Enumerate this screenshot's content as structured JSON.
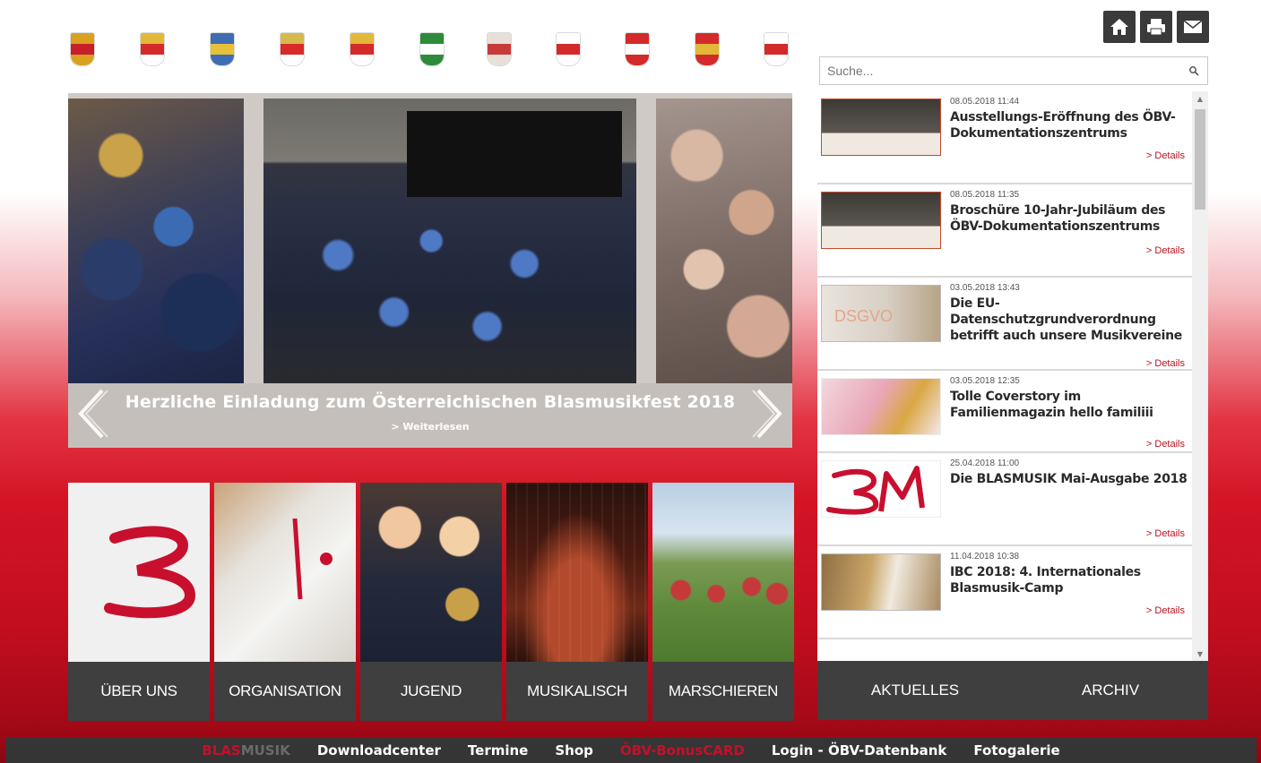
{
  "crests": [
    {
      "name": "crest-burgenland",
      "colors": [
        "#d9a11f",
        "#c8202b",
        "#d9a11f"
      ]
    },
    {
      "name": "crest-kaernten",
      "colors": [
        "#e2b838",
        "#d42a2a",
        "#ffffff"
      ]
    },
    {
      "name": "crest-niederoesterreich",
      "colors": [
        "#3f6db3",
        "#e8c13a",
        "#3f6db3"
      ]
    },
    {
      "name": "crest-oberoesterreich",
      "colors": [
        "#d6b94c",
        "#d82a2a",
        "#ffffff"
      ]
    },
    {
      "name": "crest-salzburg",
      "colors": [
        "#e2b838",
        "#d42a2a",
        "#ffffff"
      ]
    },
    {
      "name": "crest-steiermark",
      "colors": [
        "#2e8b3a",
        "#ffffff",
        "#2e8b3a"
      ]
    },
    {
      "name": "crest-suedtirol",
      "colors": [
        "#e8e0d8",
        "#c83a3a",
        "#e8e0d8"
      ]
    },
    {
      "name": "crest-tirol",
      "colors": [
        "#ffffff",
        "#d42a2a",
        "#ffffff"
      ]
    },
    {
      "name": "crest-vorarlberg",
      "colors": [
        "#d42a2a",
        "#ffffff",
        "#d42a2a"
      ]
    },
    {
      "name": "crest-wien",
      "colors": [
        "#d42a2a",
        "#e2b838",
        "#d42a2a"
      ]
    },
    {
      "name": "crest-liechtenstein",
      "colors": [
        "#ffffff",
        "#d42a2a",
        "#ffffff"
      ]
    }
  ],
  "top_icons": [
    {
      "name": "home-icon"
    },
    {
      "name": "printer-icon"
    },
    {
      "name": "mail-icon"
    }
  ],
  "search": {
    "placeholder": "Suche..."
  },
  "slider": {
    "title": "Herzliche Einladung zum Österreichischen Blasmusikfest 2018",
    "link": "> Weiterlesen"
  },
  "tiles": [
    {
      "name": "tile-ueber-uns",
      "label": "ÜBER UNS"
    },
    {
      "name": "tile-organisation",
      "label": "ORGANISATION"
    },
    {
      "name": "tile-jugend",
      "label": "JUGEND"
    },
    {
      "name": "tile-musikalisch",
      "label": "MUSIKALISCH"
    },
    {
      "name": "tile-marschieren",
      "label": "MARSCHIEREN"
    }
  ],
  "news": [
    {
      "date": "08.05.2018 11:44",
      "title": "Ausstellungs-Eröffnung des ÖBV-Dokumentationszentrums",
      "details": "> Details"
    },
    {
      "date": "08.05.2018 11:35",
      "title": "Broschüre 10-Jahr-Jubiläum des ÖBV-Dokumentationszentrums",
      "details": "> Details"
    },
    {
      "date": "03.05.2018 13:43",
      "title": "Die EU-Datenschutzgrundverordnung betrifft auch unsere Musikvereine",
      "details": "> Details",
      "thumb_text": "DSGVO"
    },
    {
      "date": "03.05.2018 12:35",
      "title": "Tolle Coverstory im Familienmagazin hello familiii",
      "details": "> Details"
    },
    {
      "date": "25.04.2018 11:00",
      "title": "Die BLASMUSIK Mai-Ausgabe 2018",
      "details": "> Details"
    },
    {
      "date": "11.04.2018 10:38",
      "title": "IBC 2018: 4. Internationales Blasmusik-Camp",
      "details": "> Details"
    }
  ],
  "news_tabs": {
    "aktuelles": "AKTUELLES",
    "archiv": "ARCHIV"
  },
  "footer": {
    "brand_part1": "BLAS",
    "brand_part2": "MUSIK",
    "items": [
      "Downloadcenter",
      "Termine",
      "Shop",
      "ÖBV-BonusCARD",
      "Login - ÖBV-Datenbank",
      "Fotogalerie"
    ]
  },
  "colors": {
    "accent_red": "#c3102a",
    "dark_bar": "#3f3f3f"
  }
}
